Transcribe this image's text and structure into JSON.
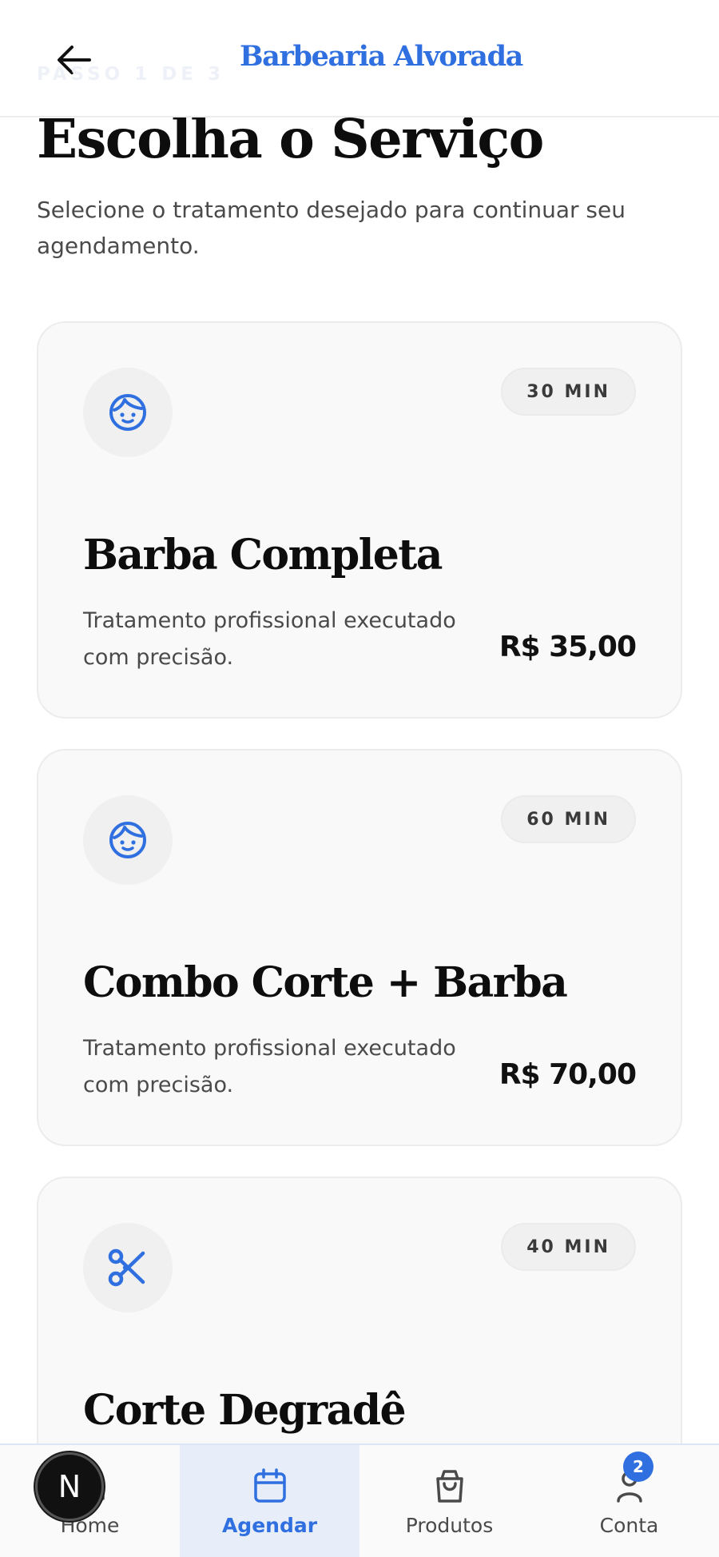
{
  "header": {
    "brand": "Barbearia Alvorada",
    "step": "PASSO 1 DE 3"
  },
  "intro": {
    "title": "Escolha o Serviço",
    "subtitle": "Selecione o tratamento desejado para continuar seu agendamento."
  },
  "services": [
    {
      "name": "Barba Completa",
      "duration": "30 MIN",
      "description": "Tratamento profissional executado com precisão.",
      "price": "R$ 35,00",
      "icon": "face-icon"
    },
    {
      "name": "Combo Corte + Barba",
      "duration": "60 MIN",
      "description": "Tratamento profissional executado com precisão.",
      "price": "R$ 70,00",
      "icon": "face-icon"
    },
    {
      "name": "Corte Degradê",
      "duration": "40 MIN",
      "description": "",
      "price": "",
      "icon": "scissors-icon"
    }
  ],
  "nav": {
    "items": [
      {
        "label": "Home",
        "icon": "home-icon"
      },
      {
        "label": "Agendar",
        "icon": "calendar-icon",
        "active": true
      },
      {
        "label": "Produtos",
        "icon": "shopping-bag-icon"
      },
      {
        "label": "Conta",
        "icon": "user-icon",
        "badge": "2"
      }
    ]
  },
  "fab": {
    "letter": "N"
  },
  "colors": {
    "accent": "#2f6fe0",
    "text": "#0d0d0d",
    "muted": "#4a4a4a",
    "card_bg": "#f9f9f9",
    "nav_active_bg": "#e7eef9"
  }
}
